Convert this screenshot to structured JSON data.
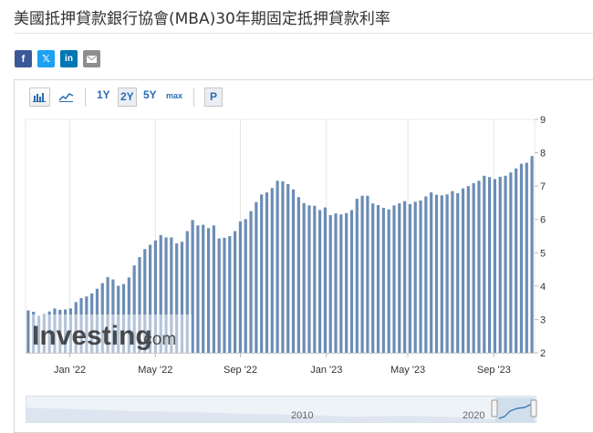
{
  "page": {
    "title": "美國抵押貸款銀行協會(MBA)30年期固定抵押貸款利率"
  },
  "share": {
    "facebook": "f",
    "twitter": "𝕏",
    "linkedin": "in",
    "email_icon": "envelope-icon"
  },
  "toolbar": {
    "bar_icon": "bar-chart-icon",
    "line_icon": "line-chart-icon",
    "range_1y": "1Y",
    "range_2y": "2Y",
    "range_5y": "5Y",
    "range_max": "max",
    "p_label": "P",
    "selected_range": "2Y"
  },
  "watermark": {
    "brand": "Investing",
    "suffix": ".com"
  },
  "navigator": {
    "labels": [
      "2010",
      "2020"
    ]
  },
  "colors": {
    "bar": "#6b8db5",
    "grid": "#e6e6e6",
    "axis_text": "#333333",
    "link": "#2a6cb0"
  },
  "chart_data": {
    "type": "bar",
    "x_tick_labels": [
      "Jan '22",
      "May '22",
      "Sep '22",
      "Jan '23",
      "May '23",
      "Sep '23"
    ],
    "y_ticks": [
      2,
      3,
      4,
      5,
      6,
      7,
      8,
      9
    ],
    "ylim": [
      2,
      9
    ],
    "y_axis_side": "right",
    "grid": "vertical",
    "series": [
      {
        "values": [
          3.27,
          3.23,
          3.11,
          3.16,
          3.24,
          3.33,
          3.29,
          3.3,
          3.33,
          3.52,
          3.64,
          3.69,
          3.78,
          3.92,
          4.09,
          4.27,
          4.2,
          4.01,
          4.06,
          4.26,
          4.62,
          4.87,
          5.11,
          5.24,
          5.37,
          5.53,
          5.46,
          5.46,
          5.28,
          5.33,
          5.65,
          5.98,
          5.82,
          5.84,
          5.74,
          5.82,
          5.43,
          5.45,
          5.5,
          5.65,
          5.94,
          6.01,
          6.25,
          6.52,
          6.75,
          6.81,
          6.94,
          7.16,
          7.14,
          7.06,
          6.9,
          6.67,
          6.49,
          6.42,
          6.41,
          6.28,
          6.36,
          6.13,
          6.18,
          6.15,
          6.19,
          6.28,
          6.62,
          6.71,
          6.71,
          6.48,
          6.43,
          6.35,
          6.3,
          6.42,
          6.48,
          6.55,
          6.46,
          6.53,
          6.57,
          6.69,
          6.81,
          6.74,
          6.72,
          6.75,
          6.85,
          6.79,
          6.93,
          7.0,
          7.09,
          7.16,
          7.31,
          7.27,
          7.21,
          7.28,
          7.31,
          7.41,
          7.53,
          7.67,
          7.7,
          7.9
        ]
      }
    ]
  }
}
